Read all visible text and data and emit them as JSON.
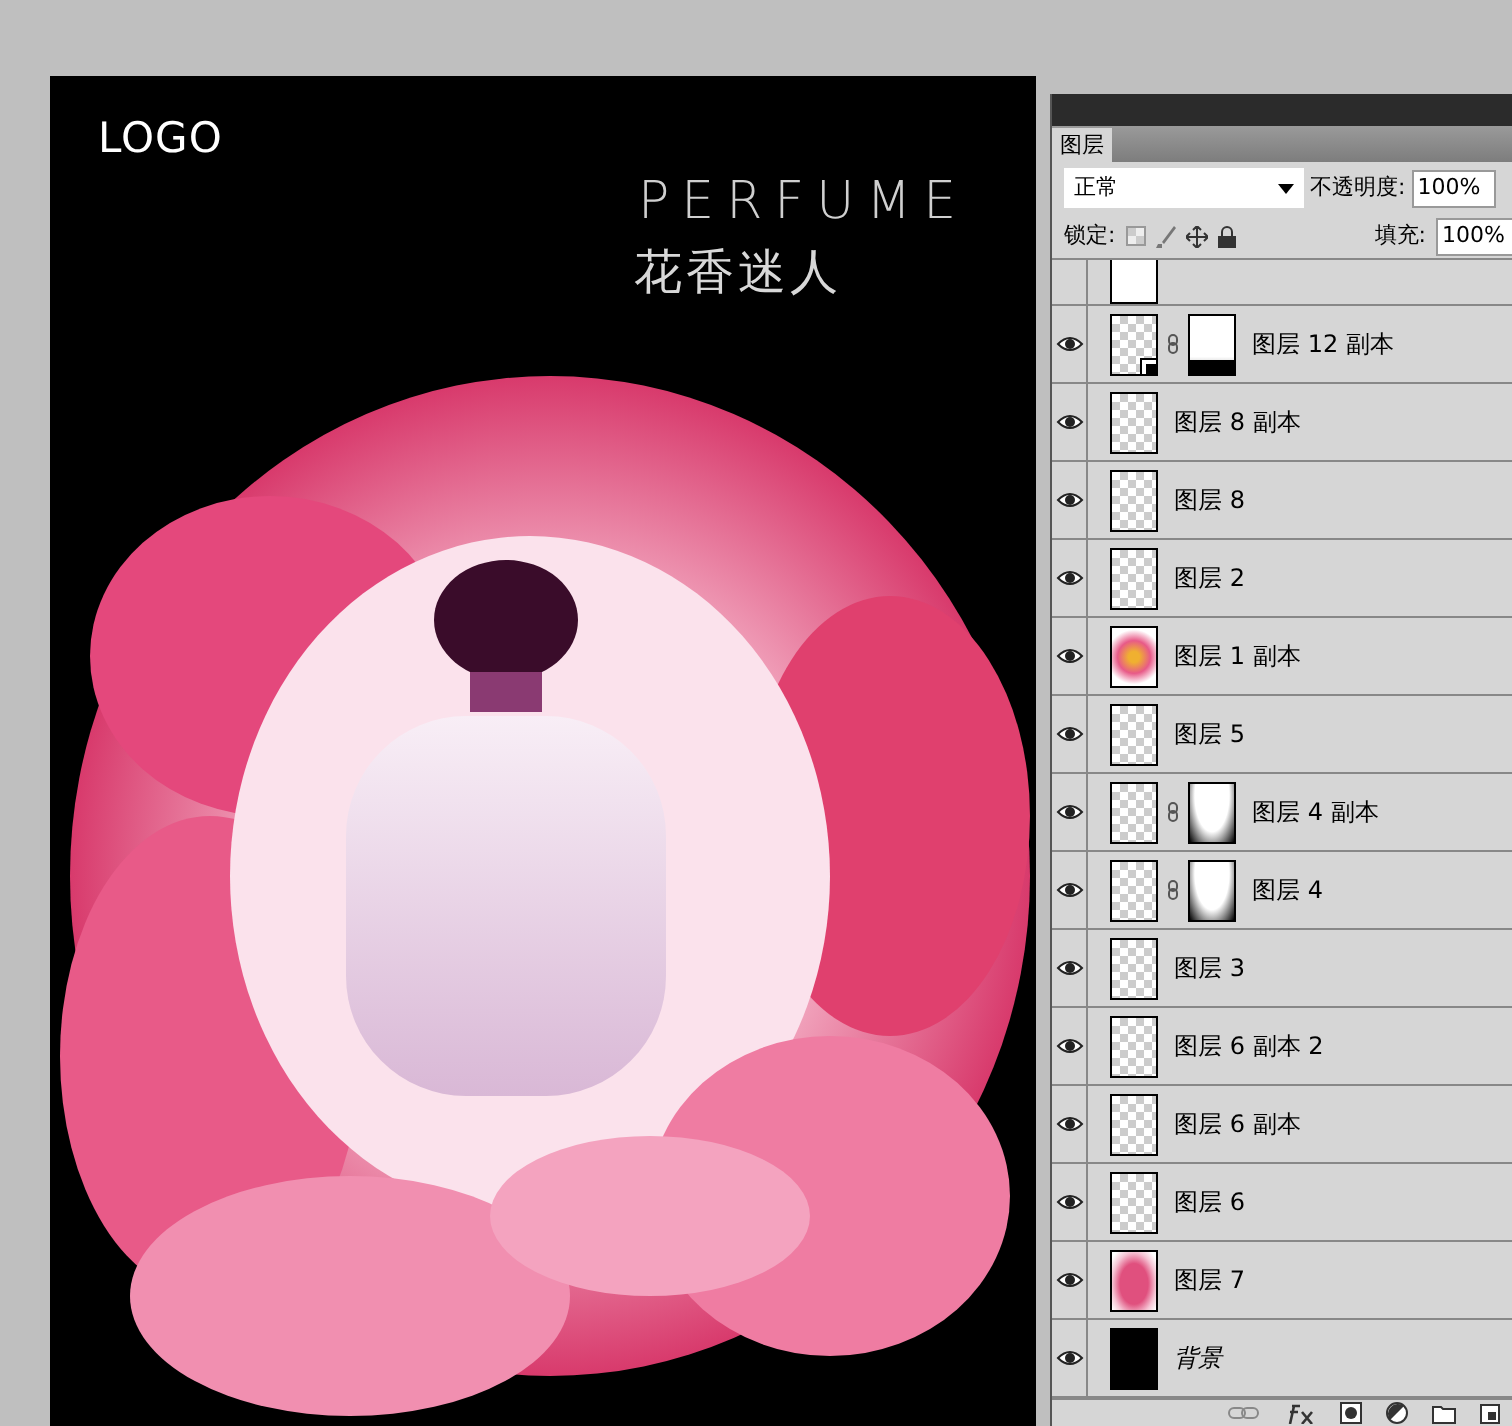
{
  "canvas": {
    "logo": "LOGO",
    "headline": "PERFUME",
    "tagline": "花香迷人"
  },
  "layers_panel": {
    "tab": {
      "label": "图层",
      "selected": true
    },
    "blend_mode": "正常",
    "opacity_label": "不透明度:",
    "opacity": "100%",
    "lock_label": "锁定:",
    "fill_label": "填充:",
    "fill": "100%",
    "layers": [
      {
        "name": "图层 12 副本",
        "visible": true,
        "thumbnail": {
          "kind": "transparent"
        },
        "smart_object": true,
        "mask": {
          "kind": "bottombar"
        },
        "background": false
      },
      {
        "name": "图层 8 副本",
        "visible": true,
        "thumbnail": {
          "kind": "transparent"
        },
        "smart_object": false,
        "background": false
      },
      {
        "name": "图层 8",
        "visible": true,
        "thumbnail": {
          "kind": "transparent"
        },
        "smart_object": false,
        "background": false
      },
      {
        "name": "图层 2",
        "visible": true,
        "thumbnail": {
          "kind": "transparent"
        },
        "smart_object": false,
        "background": false
      },
      {
        "name": "图层 1 副本",
        "visible": true,
        "thumbnail": {
          "kind": "flower"
        },
        "smart_object": false,
        "background": false
      },
      {
        "name": "图层 5",
        "visible": true,
        "thumbnail": {
          "kind": "transparent"
        },
        "smart_object": false,
        "background": false
      },
      {
        "name": "图层 4 副本",
        "visible": true,
        "thumbnail": {
          "kind": "transparent"
        },
        "smart_object": false,
        "mask": {
          "kind": "vignette"
        },
        "background": false
      },
      {
        "name": "图层 4",
        "visible": true,
        "thumbnail": {
          "kind": "transparent"
        },
        "smart_object": false,
        "mask": {
          "kind": "vignette"
        },
        "background": false
      },
      {
        "name": "图层 3",
        "visible": true,
        "thumbnail": {
          "kind": "transparent"
        },
        "smart_object": false,
        "background": false
      },
      {
        "name": "图层 6 副本 2",
        "visible": true,
        "thumbnail": {
          "kind": "transparent"
        },
        "smart_object": false,
        "background": false
      },
      {
        "name": "图层 6 副本",
        "visible": true,
        "thumbnail": {
          "kind": "transparent"
        },
        "smart_object": false,
        "background": false
      },
      {
        "name": "图层 6",
        "visible": true,
        "thumbnail": {
          "kind": "transparent"
        },
        "smart_object": false,
        "background": false
      },
      {
        "name": "图层 7",
        "visible": true,
        "thumbnail": {
          "kind": "pink"
        },
        "smart_object": false,
        "background": false
      },
      {
        "name": "背景",
        "visible": true,
        "thumbnail": {
          "kind": "black"
        },
        "smart_object": false,
        "background": true
      }
    ]
  }
}
